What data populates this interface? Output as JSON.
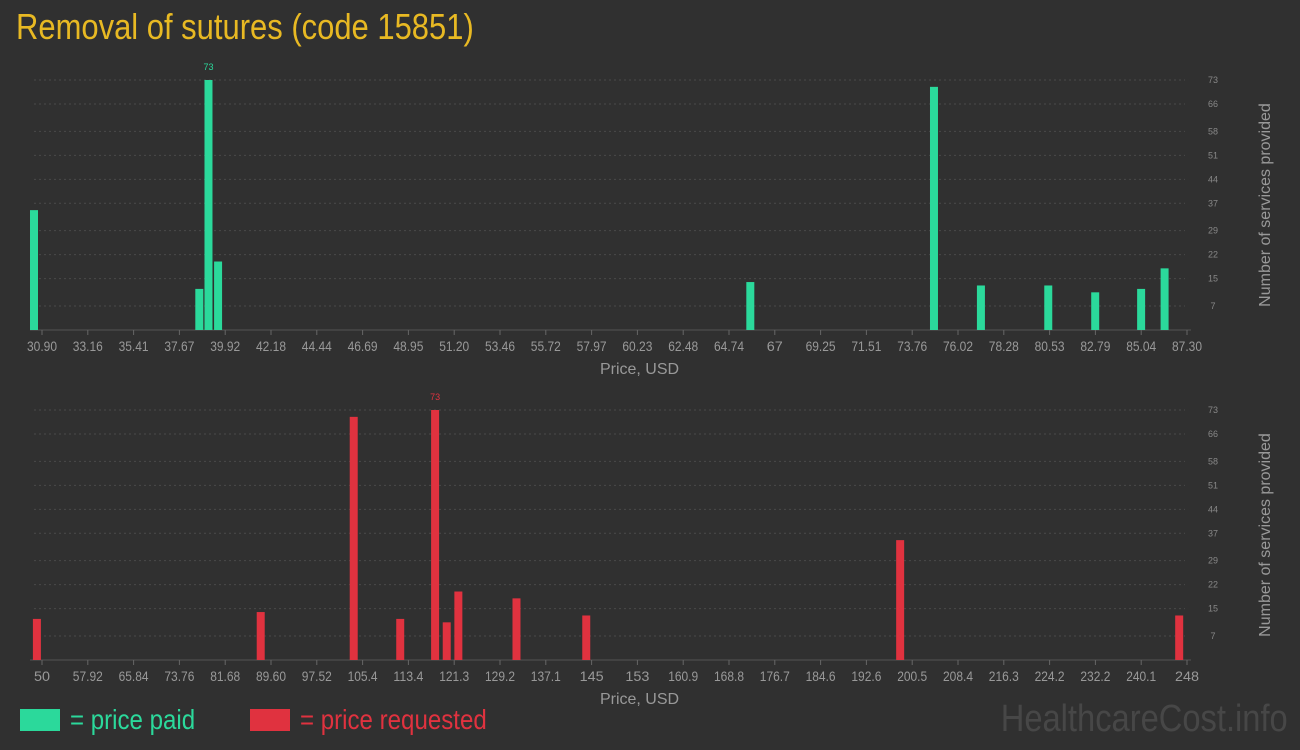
{
  "title": "Removal of sutures (code 15851)",
  "colors": {
    "paid": "#2bd99b",
    "requested": "#e0323f",
    "title": "#e8b923",
    "background": "#303030"
  },
  "legend": {
    "paid": "= price paid",
    "requested": "= price requested"
  },
  "watermark": "HealthcareCost.info",
  "chart_data": [
    {
      "type": "bar",
      "xlabel": "Price, USD",
      "ylabel": "Number of services provided",
      "ylim": [
        0,
        73
      ],
      "ytick_labels": [
        "7",
        "15",
        "22",
        "29",
        "37",
        "44",
        "51",
        "58",
        "66",
        "73"
      ],
      "xtick_labels": [
        "30.90",
        "33.16",
        "35.41",
        "37.67",
        "39.92",
        "42.18",
        "44.44",
        "46.69",
        "48.95",
        "51.20",
        "53.46",
        "55.72",
        "57.97",
        "60.23",
        "62.48",
        "64.74",
        "67",
        "69.25",
        "71.51",
        "73.76",
        "76.02",
        "78.28",
        "80.53",
        "82.79",
        "85.04",
        "87.30"
      ],
      "xrange": [
        30.9,
        87.3
      ],
      "grid": true,
      "max_label": "73",
      "series": [
        {
          "color": "#2bd99b",
          "points": [
            {
              "x": 30.9,
              "y": 35
            },
            {
              "x": 39.0,
              "y": 12
            },
            {
              "x": 39.45,
              "y": 73
            },
            {
              "x": 39.92,
              "y": 20
            },
            {
              "x": 66.0,
              "y": 14
            },
            {
              "x": 75.0,
              "y": 71
            },
            {
              "x": 77.3,
              "y": 13
            },
            {
              "x": 80.6,
              "y": 13
            },
            {
              "x": 82.9,
              "y": 11
            },
            {
              "x": 85.15,
              "y": 12
            },
            {
              "x": 86.3,
              "y": 18
            }
          ]
        }
      ]
    },
    {
      "type": "bar",
      "xlabel": "Price, USD",
      "ylabel": "Number of services provided",
      "ylim": [
        0,
        73
      ],
      "ytick_labels": [
        "7",
        "15",
        "22",
        "29",
        "37",
        "44",
        "51",
        "58",
        "66",
        "73"
      ],
      "xtick_labels": [
        "50",
        "57.92",
        "65.84",
        "73.76",
        "81.68",
        "89.60",
        "97.52",
        "105.4",
        "113.4",
        "121.3",
        "129.2",
        "137.1",
        "145",
        "153",
        "160.9",
        "168.8",
        "176.7",
        "184.6",
        "192.6",
        "200.5",
        "208.4",
        "216.3",
        "224.2",
        "232.2",
        "240.1",
        "248"
      ],
      "xrange": [
        50,
        248
      ],
      "grid": true,
      "max_label": "73",
      "series": [
        {
          "color": "#e0323f",
          "points": [
            {
              "x": 50.5,
              "y": 12
            },
            {
              "x": 89.0,
              "y": 14
            },
            {
              "x": 105.0,
              "y": 71
            },
            {
              "x": 113.0,
              "y": 12
            },
            {
              "x": 119.0,
              "y": 73
            },
            {
              "x": 121.0,
              "y": 11
            },
            {
              "x": 123.0,
              "y": 20
            },
            {
              "x": 133.0,
              "y": 18
            },
            {
              "x": 145.0,
              "y": 13
            },
            {
              "x": 199.0,
              "y": 35
            },
            {
              "x": 247.0,
              "y": 13
            }
          ]
        }
      ]
    }
  ]
}
